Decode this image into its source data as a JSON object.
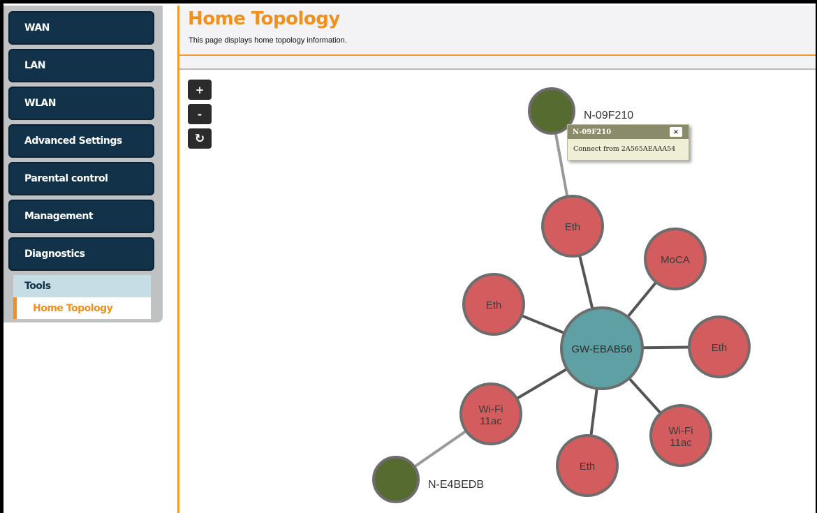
{
  "sidebar": {
    "items": [
      {
        "label": "WAN"
      },
      {
        "label": "LAN"
      },
      {
        "label": "WLAN"
      },
      {
        "label": "Advanced Settings"
      },
      {
        "label": "Parental control"
      },
      {
        "label": "Management"
      },
      {
        "label": "Diagnostics"
      }
    ],
    "sub_items": [
      {
        "label": "Tools"
      },
      {
        "label": "Home Topology",
        "active": true
      }
    ]
  },
  "header": {
    "title": "Home Topology",
    "description": "This page displays home topology information."
  },
  "controls": {
    "zoom_in": "+",
    "zoom_out": "-",
    "refresh": "↻"
  },
  "topology": {
    "gateway": {
      "label": "GW-EBAB56"
    },
    "interfaces": [
      {
        "id": "eth_top",
        "label": "Eth"
      },
      {
        "id": "moca",
        "label": "MoCA"
      },
      {
        "id": "eth_left",
        "label": "Eth"
      },
      {
        "id": "eth_right",
        "label": "Eth"
      },
      {
        "id": "wifi_left",
        "label_line1": "Wi-Fi",
        "label_line2": "11ac"
      },
      {
        "id": "wifi_right",
        "label_line1": "Wi-Fi",
        "label_line2": "11ac"
      },
      {
        "id": "eth_bottom",
        "label": "Eth"
      }
    ],
    "clients": [
      {
        "id": "n09f210",
        "label": "N-09F210"
      },
      {
        "id": "ne4bedb",
        "label": "N-E4BEDB"
      }
    ]
  },
  "tooltip": {
    "title": "N-09F210",
    "close": "×",
    "body": "Connect from 2A565AEAAA54"
  },
  "colors": {
    "accent": "#f0901e",
    "nav_bg": "#12324a",
    "gateway": "#5ea0a4",
    "interface": "#d35c5e",
    "client": "#556b2f",
    "node_stroke": "#6d6d6d"
  }
}
